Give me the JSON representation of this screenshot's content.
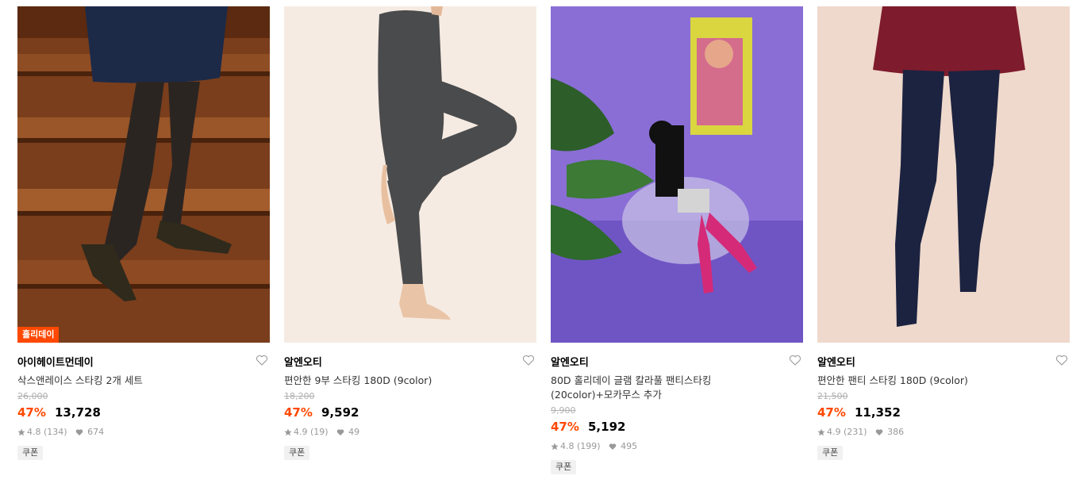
{
  "colors": {
    "accent": "#ff4800",
    "muted": "#999999"
  },
  "products": [
    {
      "badge": "홀리데이",
      "brand": "아이헤이트먼데이",
      "name": "삭스앤레이스 스타킹 2개 세트",
      "original_price": "26,000",
      "discount": "47%",
      "price": "13,728",
      "rating": "4.8",
      "reviews": "(134)",
      "likes": "674",
      "tag": "쿠폰",
      "image": "fishnet-tights-photo"
    },
    {
      "badge": "",
      "brand": "알엔오티",
      "name": "편안한 9부 스타킹 180D (9color)",
      "original_price": "18,200",
      "discount": "47%",
      "price": "9,592",
      "rating": "4.9",
      "reviews": "(19)",
      "likes": "49",
      "tag": "쿠폰",
      "image": "grey-leggings-photo"
    },
    {
      "badge": "",
      "brand": "알엔오티",
      "name_line1": "80D 홀리데이 글램 칼라풀 팬티스타킹",
      "name_line2": "(20color)+모카무스 추가",
      "original_price": "9,900",
      "discount": "47%",
      "price": "5,192",
      "rating": "4.8",
      "reviews": "(199)",
      "likes": "495",
      "tag": "쿠폰",
      "image": "purple-room-pink-tights-photo"
    },
    {
      "badge": "",
      "brand": "알엔오티",
      "name": "편안한 팬티 스타킹 180D (9color)",
      "original_price": "21,500",
      "discount": "47%",
      "price": "11,352",
      "rating": "4.9",
      "reviews": "(231)",
      "likes": "386",
      "tag": "쿠폰",
      "image": "navy-tights-photo"
    }
  ]
}
